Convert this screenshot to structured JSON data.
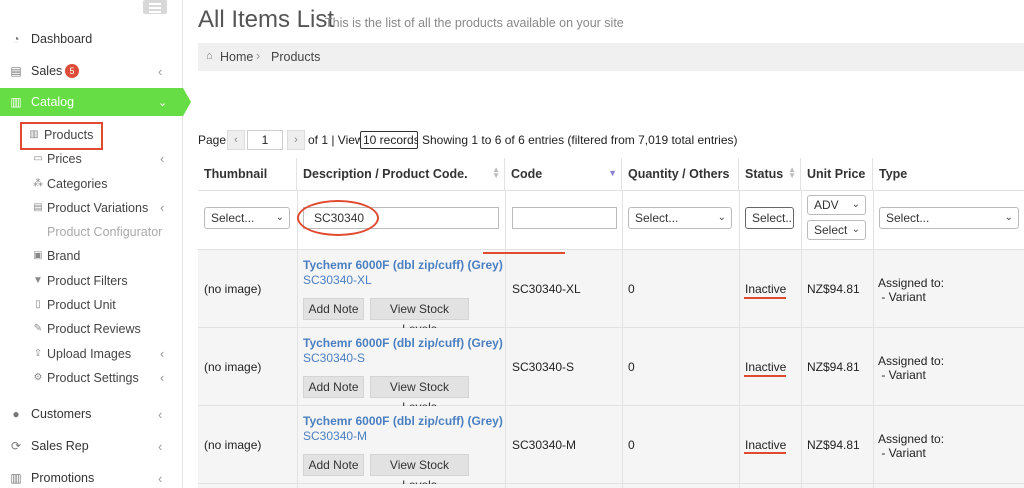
{
  "sidebar": {
    "items": [
      {
        "label": "Dashboard"
      },
      {
        "label": "Sales",
        "badge": "5"
      },
      {
        "label": "Catalog"
      },
      {
        "label": "Customers"
      },
      {
        "label": "Sales Rep"
      },
      {
        "label": "Promotions"
      }
    ],
    "catalog_sub": [
      {
        "label": "Products"
      },
      {
        "label": "Prices"
      },
      {
        "label": "Categories"
      },
      {
        "label": "Product Variations"
      },
      {
        "label": "Product Configurator"
      },
      {
        "label": "Brand"
      },
      {
        "label": "Product Filters"
      },
      {
        "label": "Product Unit"
      },
      {
        "label": "Product Reviews"
      },
      {
        "label": "Upload Images"
      },
      {
        "label": "Product Settings"
      }
    ]
  },
  "header": {
    "title": "All Items List",
    "subtitle": "This is the list of all the products available on your site"
  },
  "breadcrumb": {
    "home": "Home",
    "current": "Products"
  },
  "pager": {
    "page_label": "Page",
    "page_value": "1",
    "of_text": "of 1 | View",
    "records": "10 records",
    "entries_text": "Showing 1 to 6 of 6 entries (filtered from 7,019 total entries)"
  },
  "table": {
    "columns": [
      "Thumbnail",
      "Description / Product Code.",
      "Code",
      "Quantity / Others",
      "Status",
      "Unit Price",
      "Type"
    ],
    "filters": {
      "thumbnail": "Select...",
      "description": "SC30340",
      "code": "",
      "quantity": "Select...",
      "status": "Select...",
      "unit_price_1": "ADV",
      "unit_price_2": "Select",
      "type": "Select..."
    },
    "rows": [
      {
        "thumb": "(no image)",
        "name": "Tychemr 6000F (dbl zip/cuff) (Grey)",
        "code_link": "SC30340-XL",
        "code": "SC30340-XL",
        "qty": "0",
        "status": "Inactive",
        "price": "NZ$94.81",
        "type": "Assigned to:\n - Variant"
      },
      {
        "thumb": "(no image)",
        "name": "Tychemr 6000F (dbl zip/cuff) (Grey)",
        "code_link": "SC30340-S",
        "code": "SC30340-S",
        "qty": "0",
        "status": "Inactive",
        "price": "NZ$94.81",
        "type": "Assigned to:\n - Variant"
      },
      {
        "thumb": "(no image)",
        "name": "Tychemr 6000F (dbl zip/cuff) (Grey)",
        "code_link": "SC30340-M",
        "code": "SC30340-M",
        "qty": "0",
        "status": "Inactive",
        "price": "NZ$94.81",
        "type": "Assigned to:\n - Variant"
      }
    ],
    "add_note_label": "Add Note",
    "view_stock_label": "View Stock Levels"
  },
  "colors": {
    "catalog_active": "#66dd44",
    "annotation": "#e04a2f",
    "link": "#4a7fc1"
  }
}
